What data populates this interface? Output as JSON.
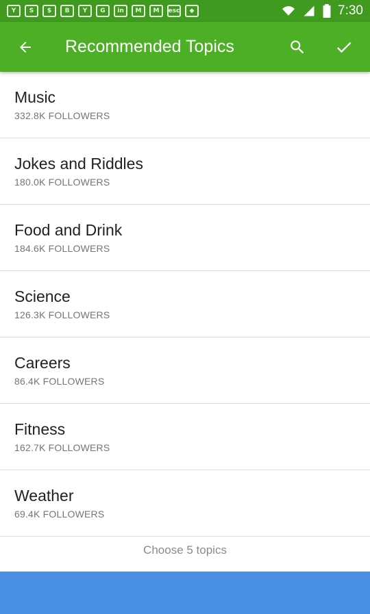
{
  "status_bar": {
    "time": "7:30",
    "notification_icons": [
      "Y",
      "S",
      "$",
      "B",
      "Y",
      "G",
      "in",
      "M",
      "M",
      "esc",
      "◆"
    ]
  },
  "app_bar": {
    "title": "Recommended Topics",
    "background": "#4caf26"
  },
  "topics": [
    {
      "name": "Music",
      "followers": "332.8K FOLLOWERS"
    },
    {
      "name": "Jokes and Riddles",
      "followers": "180.0K FOLLOWERS"
    },
    {
      "name": "Food and Drink",
      "followers": "184.6K FOLLOWERS"
    },
    {
      "name": "Science",
      "followers": "126.3K FOLLOWERS"
    },
    {
      "name": "Careers",
      "followers": "86.4K FOLLOWERS"
    },
    {
      "name": "Fitness",
      "followers": "162.7K FOLLOWERS"
    },
    {
      "name": "Weather",
      "followers": "69.4K FOLLOWERS"
    }
  ],
  "footer": {
    "hint": "Choose 5 topics"
  },
  "colors": {
    "status_bar": "#3f9a1f",
    "bottom_bar": "#4a90e2"
  }
}
